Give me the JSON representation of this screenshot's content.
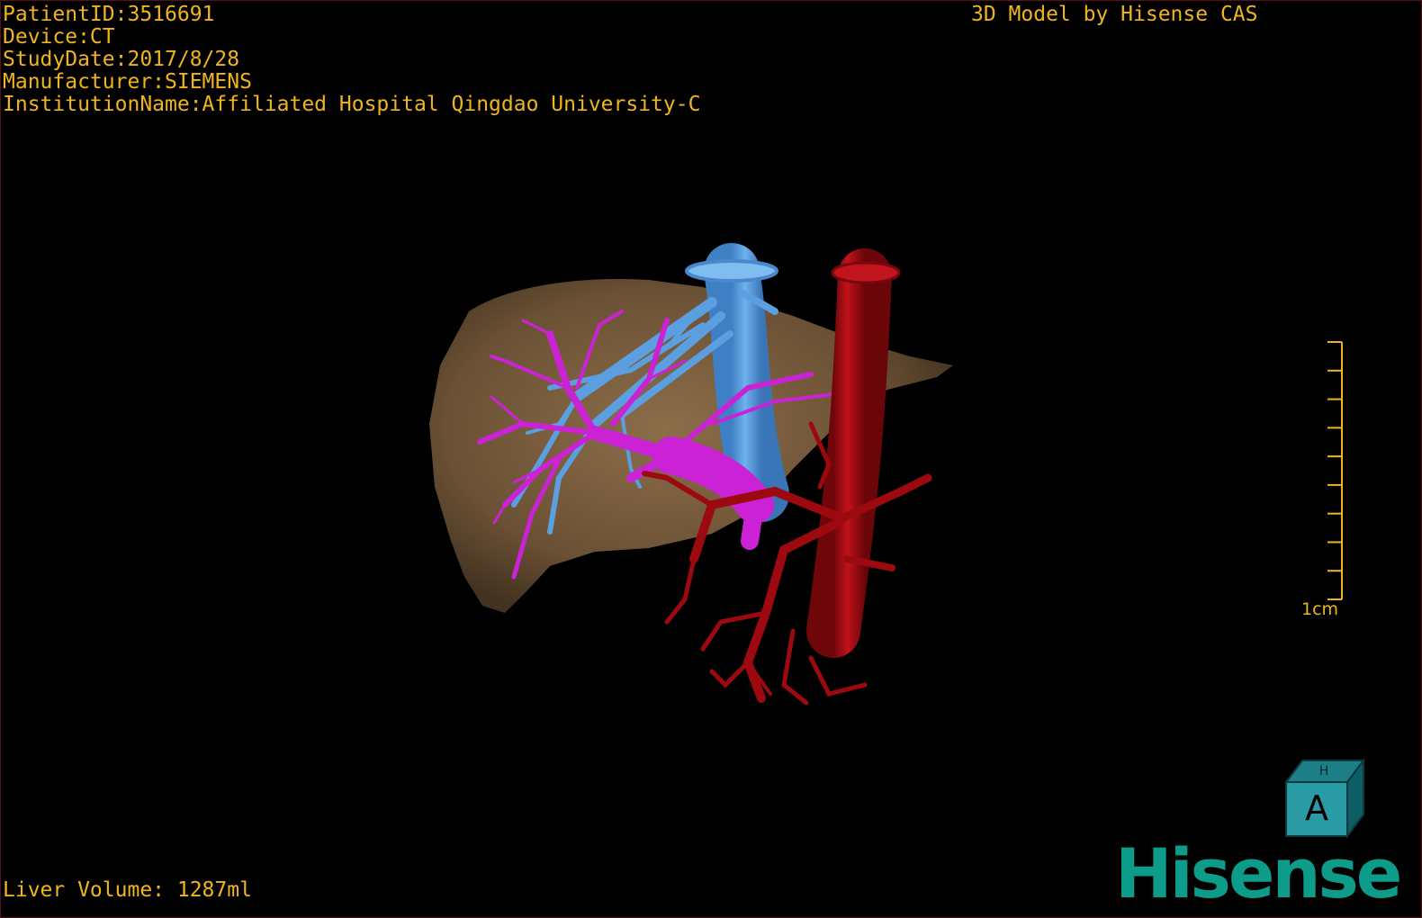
{
  "patient_info": {
    "patient_id": "PatientID:3516691",
    "device": "Device:CT",
    "study_date": "StudyDate:2017/8/28",
    "manufacturer": "Manufacturer:SIEMENS",
    "institution": "InstitutionName:Affiliated Hospital Qingdao University-C"
  },
  "model_credit": "3D Model by Hisense CAS",
  "liver_volume": "Liver Volume: 1287ml",
  "scale_bar": {
    "label": "1cm",
    "ticks": 10
  },
  "orientation_cube": {
    "front_face": "A",
    "top_face": "H"
  },
  "brand_logo": "Hisense",
  "colors": {
    "overlay_text": "#f0b420",
    "liver": "#8b6a45",
    "hepatic_vein": "#5b9fe0",
    "portal_vein": "#cc22d6",
    "artery_aorta": "#9c0a10",
    "brand": "#0d9c8a"
  }
}
